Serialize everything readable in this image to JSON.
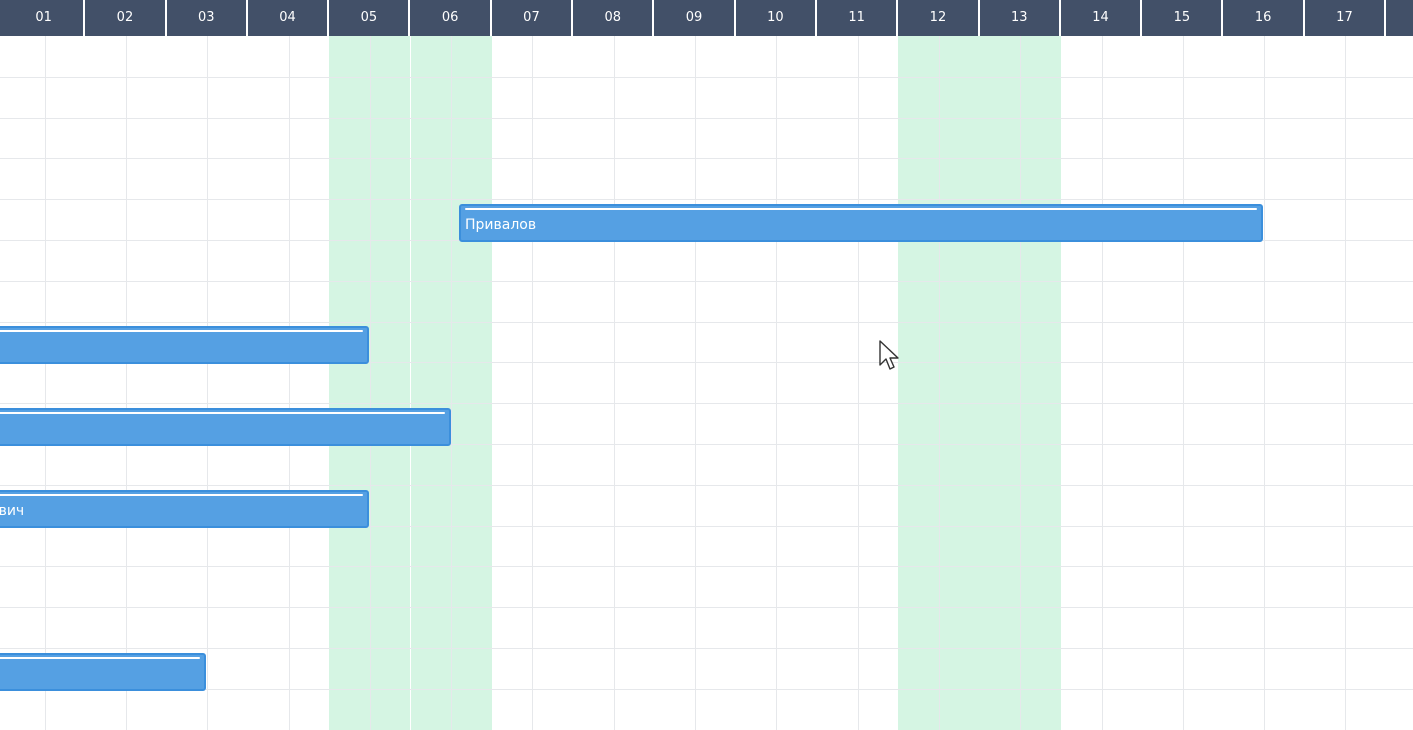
{
  "timeline": {
    "days": [
      "01",
      "02",
      "03",
      "04",
      "05",
      "06",
      "07",
      "08",
      "09",
      "10",
      "11",
      "12",
      "13",
      "14",
      "15",
      "16",
      "17"
    ],
    "weekend_days": [
      "05",
      "06",
      "12",
      "13"
    ]
  },
  "bars": [
    {
      "row": 5,
      "label": "Привалов"
    },
    {
      "row": 8,
      "label": ""
    },
    {
      "row": 10,
      "label": ""
    },
    {
      "row": 12,
      "label": "ович"
    },
    {
      "row": 16,
      "label": ""
    }
  ],
  "colors": {
    "header_bg": "#425068",
    "weekend_bg": "#d5f5e3",
    "bar_fill": "#55a0e3",
    "bar_border": "#3b8fdc",
    "grid_line": "#e6e8eb"
  },
  "icons": {
    "cursor": "mouse-pointer-icon"
  }
}
